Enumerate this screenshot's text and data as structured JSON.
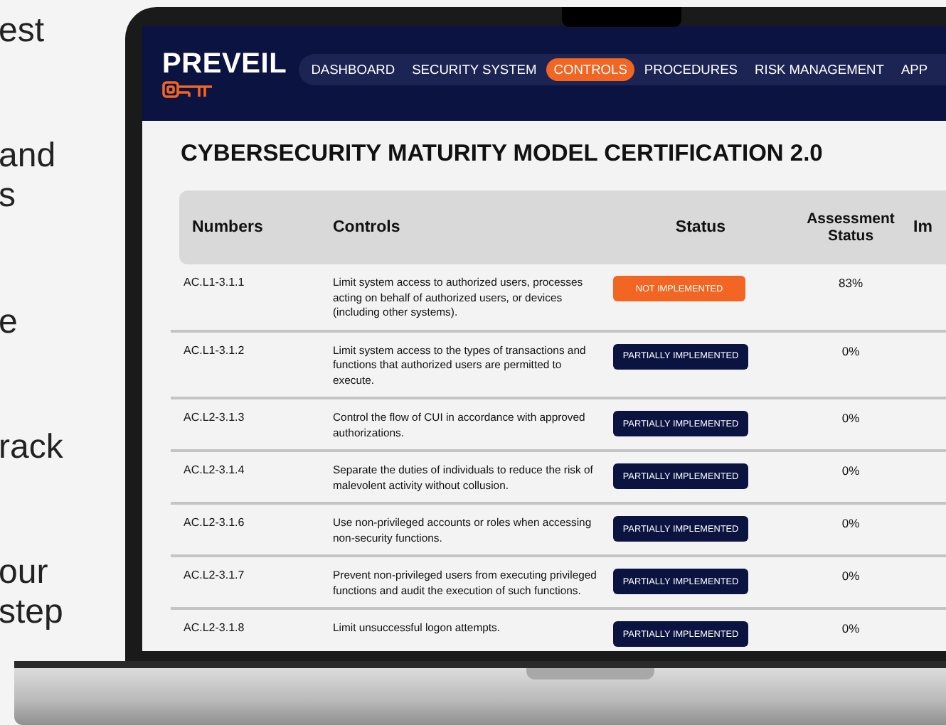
{
  "side_text": [
    [
      "est"
    ],
    [
      "and",
      "s"
    ],
    [
      "e"
    ],
    [
      "rack"
    ],
    [
      "our",
      "step"
    ]
  ],
  "app": {
    "logo": "PREVEIL",
    "nav": [
      {
        "label": "DASHBOARD",
        "selected": false
      },
      {
        "label": "SECURITY SYSTEM",
        "selected": false
      },
      {
        "label": "CONTROLS",
        "selected": true
      },
      {
        "label": "PROCEDURES",
        "selected": false
      },
      {
        "label": "RISK MANAGEMENT",
        "selected": false
      },
      {
        "label": "APP",
        "selected": false
      }
    ],
    "title": "CYBERSECURITY MATURITY MODEL CERTIFICATION 2.0",
    "table": {
      "columns": [
        "Numbers",
        "Controls",
        "Status",
        "Assessment Status",
        "Im"
      ],
      "rows": [
        {
          "number": "AC.L1-3.1.1",
          "control": "Limit system access to authorized users, processes acting on behalf of authorized users, or devices (including other systems).",
          "status": {
            "kind": "not_implemented",
            "label": "NOT IMPLEMENTED"
          },
          "assessment": "83%"
        },
        {
          "number": "AC.L1-3.1.2",
          "control": "Limit system access to the types of transactions and functions that authorized users are permitted to execute.",
          "status": {
            "kind": "partially_implemented",
            "label": "PARTIALLY IMPLEMENTED"
          },
          "assessment": "0%"
        },
        {
          "number": "AC.L2-3.1.3",
          "control": "Control the flow of CUI in accordance with approved authorizations.",
          "status": {
            "kind": "partially_implemented",
            "label": "PARTIALLY IMPLEMENTED"
          },
          "assessment": "0%"
        },
        {
          "number": "AC.L2-3.1.4",
          "control": "Separate the duties of individuals to reduce the risk of malevolent activity without collusion.",
          "status": {
            "kind": "partially_implemented",
            "label": "PARTIALLY IMPLEMENTED"
          },
          "assessment": "0%"
        },
        {
          "number": "AC.L2-3.1.6",
          "control": "Use non-privileged accounts or roles when accessing non-security functions.",
          "status": {
            "kind": "partially_implemented",
            "label": "PARTIALLY IMPLEMENTED"
          },
          "assessment": "0%"
        },
        {
          "number": "AC.L2-3.1.7",
          "control": "Prevent non-privileged users from executing privileged functions and audit the execution of such functions.",
          "status": {
            "kind": "partially_implemented",
            "label": "PARTIALLY IMPLEMENTED"
          },
          "assessment": "0%"
        },
        {
          "number": "AC.L2-3.1.8",
          "control": "Limit unsuccessful logon attempts.",
          "status": {
            "kind": "partially_implemented",
            "label": "PARTIALLY IMPLEMENTED"
          },
          "assessment": "0%"
        }
      ]
    }
  }
}
